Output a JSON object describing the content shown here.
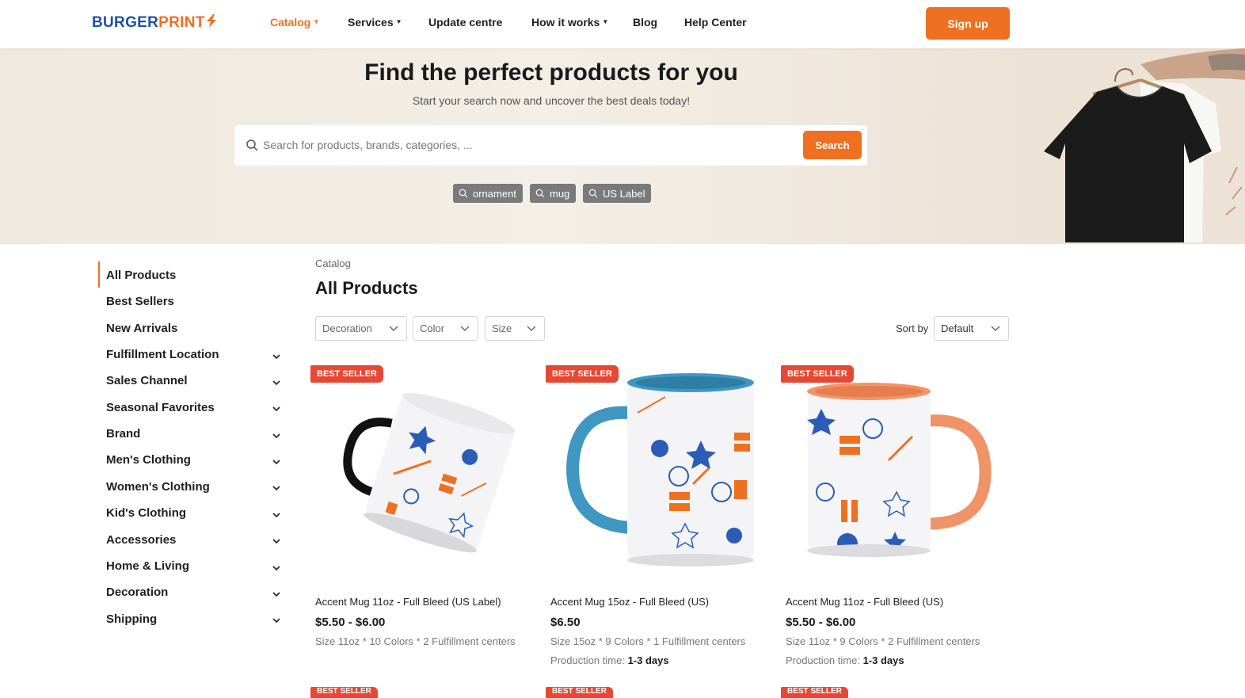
{
  "header": {
    "logo_main": "BURGERPRINT",
    "logo_split": [
      "BURGER",
      "PRINT"
    ],
    "nav": [
      {
        "label": "Catalog",
        "dropdown": true,
        "active": true
      },
      {
        "label": "Services",
        "dropdown": true,
        "active": false
      },
      {
        "label": "Update centre",
        "dropdown": false,
        "active": false
      },
      {
        "label": "How it works",
        "dropdown": true,
        "active": false
      },
      {
        "label": "Blog",
        "dropdown": false,
        "active": false
      },
      {
        "label": "Help Center",
        "dropdown": false,
        "active": false
      }
    ],
    "signup_label": "Sign up"
  },
  "hero": {
    "title": "Find the perfect products for you",
    "subtitle": "Start your search now and uncover the best deals today!",
    "search": {
      "placeholder": "Search for products, brands, categories, ...",
      "value": "",
      "button_label": "Search"
    },
    "chips": [
      "ornament",
      "mug",
      "US Label"
    ]
  },
  "sidebar": {
    "items": [
      {
        "label": "All Products",
        "expandable": false,
        "active": true
      },
      {
        "label": "Best Sellers",
        "expandable": false,
        "active": false
      },
      {
        "label": "New Arrivals",
        "expandable": false,
        "active": false
      },
      {
        "label": "Fulfillment Location",
        "expandable": true,
        "active": false
      },
      {
        "label": "Sales Channel",
        "expandable": true,
        "active": false
      },
      {
        "label": "Seasonal Favorites",
        "expandable": true,
        "active": false
      },
      {
        "label": "Brand",
        "expandable": true,
        "active": false
      },
      {
        "label": "Men's Clothing",
        "expandable": true,
        "active": false
      },
      {
        "label": "Women's Clothing",
        "expandable": true,
        "active": false
      },
      {
        "label": "Kid's Clothing",
        "expandable": true,
        "active": false
      },
      {
        "label": "Accessories",
        "expandable": true,
        "active": false
      },
      {
        "label": "Home & Living",
        "expandable": true,
        "active": false
      },
      {
        "label": "Decoration",
        "expandable": true,
        "active": false
      },
      {
        "label": "Shipping",
        "expandable": true,
        "active": false
      }
    ]
  },
  "main": {
    "breadcrumb": "Catalog",
    "title": "All Products",
    "filters": [
      "Decoration",
      "Color",
      "Size"
    ],
    "sort": {
      "label": "Sort by",
      "value": "Default"
    },
    "products": [
      {
        "badge": "BEST SELLER",
        "name": "Accent Mug 11oz - Full Bleed (US Label)",
        "price": "$5.50 - $6.00",
        "meta": "Size 11oz * 10 Colors * 2 Fulfillment centers",
        "production_label": "",
        "production_value": "",
        "accent_color": "#111111"
      },
      {
        "badge": "BEST SELLER",
        "name": "Accent Mug 15oz - Full Bleed (US)",
        "price": "$6.50",
        "meta": "Size 15oz * 9 Colors * 1 Fulfillment centers",
        "production_label": "Production time:",
        "production_value": "1-3 days",
        "accent_color": "#3f97c2"
      },
      {
        "badge": "BEST SELLER",
        "name": "Accent Mug 11oz - Full Bleed (US)",
        "price": "$5.50 - $6.00",
        "meta": "Size 11oz * 9 Colors * 2 Fulfillment centers",
        "production_label": "Production time:",
        "production_value": "1-3 days",
        "accent_color": "#f09468"
      }
    ],
    "next_row_badges": [
      "BEST SELLER",
      "BEST SELLER",
      "BEST SELLER"
    ]
  },
  "colors": {
    "brand_orange": "#ef7020",
    "brand_blue": "#1d4fa8",
    "badge_red": "#e74834",
    "chip_gray": "#7a7a7a"
  },
  "icons": {
    "search": "search-icon",
    "chevron": "chevron-down-icon",
    "caret": "caret-down-icon"
  }
}
